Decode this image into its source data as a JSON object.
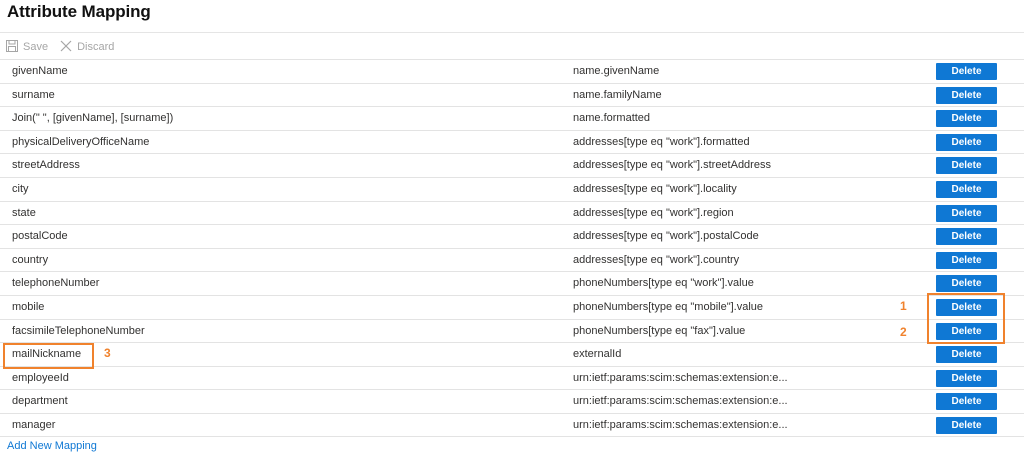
{
  "header": {
    "title": "Attribute Mapping"
  },
  "toolbar": {
    "save_label": "Save",
    "discard_label": "Discard"
  },
  "mappings": [
    {
      "source": "givenName",
      "target": "name.givenName",
      "action": "Delete"
    },
    {
      "source": "surname",
      "target": "name.familyName",
      "action": "Delete"
    },
    {
      "source": "Join(\" \", [givenName], [surname])",
      "target": "name.formatted",
      "action": "Delete"
    },
    {
      "source": "physicalDeliveryOfficeName",
      "target": "addresses[type eq \"work\"].formatted",
      "action": "Delete"
    },
    {
      "source": "streetAddress",
      "target": "addresses[type eq \"work\"].streetAddress",
      "action": "Delete"
    },
    {
      "source": "city",
      "target": "addresses[type eq \"work\"].locality",
      "action": "Delete"
    },
    {
      "source": "state",
      "target": "addresses[type eq \"work\"].region",
      "action": "Delete"
    },
    {
      "source": "postalCode",
      "target": "addresses[type eq \"work\"].postalCode",
      "action": "Delete"
    },
    {
      "source": "country",
      "target": "addresses[type eq \"work\"].country",
      "action": "Delete"
    },
    {
      "source": "telephoneNumber",
      "target": "phoneNumbers[type eq \"work\"].value",
      "action": "Delete"
    },
    {
      "source": "mobile",
      "target": "phoneNumbers[type eq \"mobile\"].value",
      "action": "Delete"
    },
    {
      "source": "facsimileTelephoneNumber",
      "target": "phoneNumbers[type eq \"fax\"].value",
      "action": "Delete"
    },
    {
      "source": "mailNickname",
      "target": "externalId",
      "action": "Delete"
    },
    {
      "source": "employeeId",
      "target": "urn:ietf:params:scim:schemas:extension:e...",
      "action": "Delete"
    },
    {
      "source": "department",
      "target": "urn:ietf:params:scim:schemas:extension:e...",
      "action": "Delete"
    },
    {
      "source": "manager",
      "target": "urn:ietf:params:scim:schemas:extension:e...",
      "action": "Delete"
    }
  ],
  "footer": {
    "add_label": "Add New Mapping"
  },
  "annotations": {
    "label_1": "1",
    "label_2": "2",
    "label_3": "3",
    "color": "#f0822d"
  },
  "colors": {
    "accent": "#0f78d4"
  },
  "icons": {
    "save": "save-icon",
    "discard": "close-icon"
  }
}
